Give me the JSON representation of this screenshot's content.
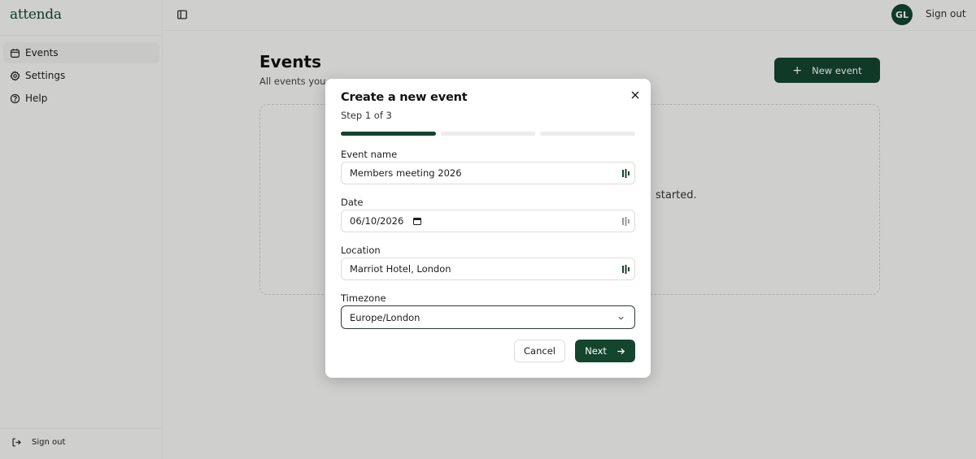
{
  "app": {
    "logo": "attenda"
  },
  "sidebar": {
    "items": [
      {
        "label": "Events",
        "icon": "calendar-icon",
        "active": true
      },
      {
        "label": "Settings",
        "icon": "gear-icon",
        "active": false
      },
      {
        "label": "Help",
        "icon": "help-circle-icon",
        "active": false
      }
    ],
    "signout_label": "Sign out"
  },
  "topbar": {
    "avatar_initials": "GL",
    "signout_label": "Sign out"
  },
  "page": {
    "title": "Events",
    "subtitle": "All events you c",
    "new_event_label": "New event",
    "empty_state_fragment": "started."
  },
  "modal": {
    "title": "Create a new event",
    "step": "Step 1 of 3",
    "progress": {
      "current": 1,
      "total": 3
    },
    "fields": {
      "event_name": {
        "label": "Event name",
        "value": "Members meeting 2026"
      },
      "date": {
        "label": "Date",
        "value": "06/10/2026"
      },
      "location": {
        "label": "Location",
        "value": "Marriot Hotel, London"
      },
      "timezone": {
        "label": "Timezone",
        "value": "Europe/London"
      }
    },
    "cancel_label": "Cancel",
    "next_label": "Next"
  },
  "colors": {
    "brand": "#14452f",
    "background": "#f7f7f6"
  }
}
